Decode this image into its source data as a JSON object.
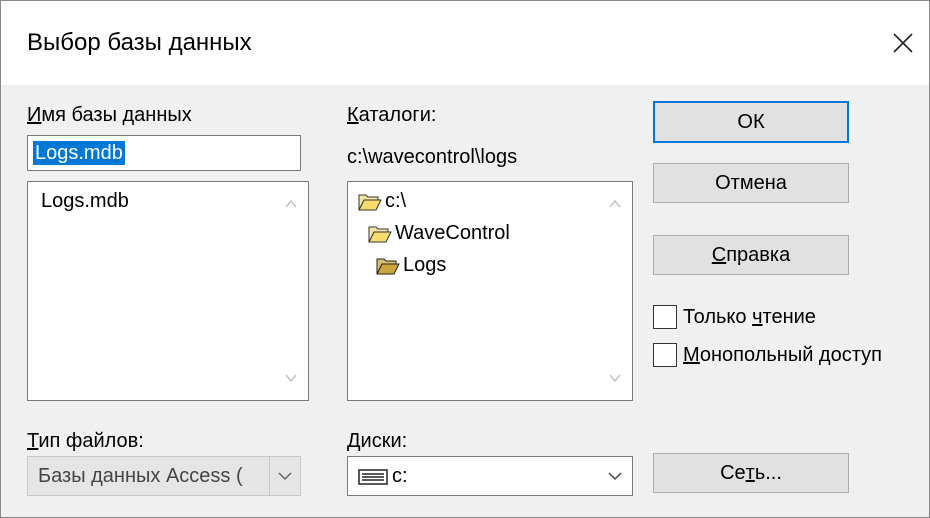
{
  "window": {
    "title": "Выбор базы данных"
  },
  "db_name": {
    "label_u": "И",
    "label_rest": "мя базы данных",
    "input_value": "Logs.mdb",
    "files": [
      "Logs.mdb"
    ]
  },
  "catalogs": {
    "label_u": "К",
    "label_rest": "аталоги:",
    "current_path": "c:\\wavecontrol\\logs",
    "folders": [
      {
        "name": "c:\\"
      },
      {
        "name": "WaveControl"
      },
      {
        "name": "Logs"
      }
    ]
  },
  "buttons": {
    "ok": "ОК",
    "cancel": "Отмена",
    "help_u": "С",
    "help_rest": "правка",
    "network_pre": "Се",
    "network_u": "т",
    "network_post": "ь..."
  },
  "checkboxes": {
    "readonly_pre": "Только ",
    "readonly_u": "ч",
    "readonly_post": "тение",
    "exclusive_u": "М",
    "exclusive_rest": "онопольный доступ"
  },
  "file_type": {
    "label_u": "Т",
    "label_rest": "ип файлов:",
    "value": "Базы данных Access ("
  },
  "drives": {
    "label_u": "Д",
    "label_rest": "иски:",
    "value": "c:"
  }
}
